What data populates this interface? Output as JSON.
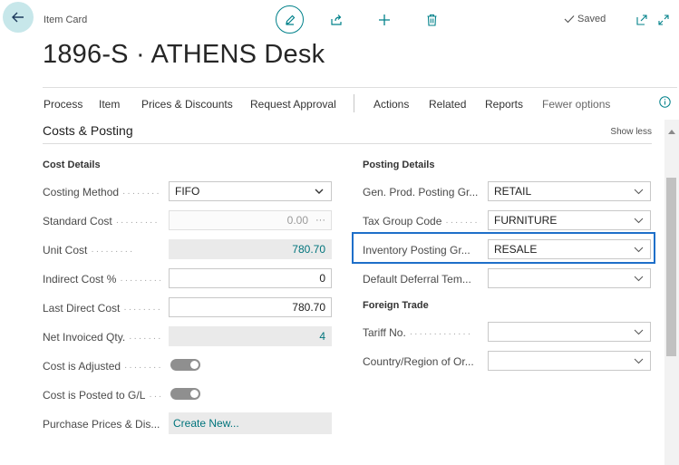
{
  "header": {
    "page_label": "Item Card",
    "title": "1896-S · ATHENS Desk",
    "saved_label": "Saved",
    "icons": [
      "back-arrow-icon",
      "edit-pencil-icon",
      "share-icon",
      "plus-icon",
      "trash-icon",
      "check-icon",
      "open-new-window-icon",
      "expand-icon"
    ],
    "accent_color": "#00818a"
  },
  "actions": {
    "items": [
      "Process",
      "Item",
      "Prices & Discounts",
      "Request Approval",
      "Actions",
      "Related",
      "Reports",
      "Fewer options"
    ]
  },
  "section": {
    "title": "Costs & Posting",
    "show_less": "Show less"
  },
  "cost_details": {
    "title": "Cost Details",
    "costing_method": {
      "label": "Costing Method",
      "value": "FIFO"
    },
    "standard_cost": {
      "label": "Standard Cost",
      "value": "0.00"
    },
    "unit_cost": {
      "label": "Unit Cost",
      "value": "780.70"
    },
    "indirect_cost": {
      "label": "Indirect Cost %",
      "value": "0"
    },
    "last_direct_cost": {
      "label": "Last Direct Cost",
      "value": "780.70"
    },
    "net_invoiced_qty": {
      "label": "Net Invoiced Qty.",
      "value": "4"
    },
    "cost_is_adjusted": {
      "label": "Cost is Adjusted",
      "value": true
    },
    "cost_posted_gl": {
      "label": "Cost is Posted to G/L",
      "value": true
    },
    "purchase_prices": {
      "label": "Purchase Prices & Dis...",
      "value": "Create New..."
    }
  },
  "posting_details": {
    "title": "Posting Details",
    "gen_prod": {
      "label": "Gen. Prod. Posting Gr...",
      "value": "RETAIL"
    },
    "tax_group": {
      "label": "Tax Group Code",
      "value": "FURNITURE"
    },
    "inventory_posting": {
      "label": "Inventory Posting Gr...",
      "value": "RESALE"
    },
    "default_deferral": {
      "label": "Default Deferral Tem...",
      "value": ""
    }
  },
  "foreign_trade": {
    "title": "Foreign Trade",
    "tariff_no": {
      "label": "Tariff No.",
      "value": ""
    },
    "country_region": {
      "label": "Country/Region of Or...",
      "value": ""
    }
  },
  "colors": {
    "focus": "#1e6fc9",
    "readonly_bg": "#eaeaea",
    "value_teal": "#00747c"
  }
}
